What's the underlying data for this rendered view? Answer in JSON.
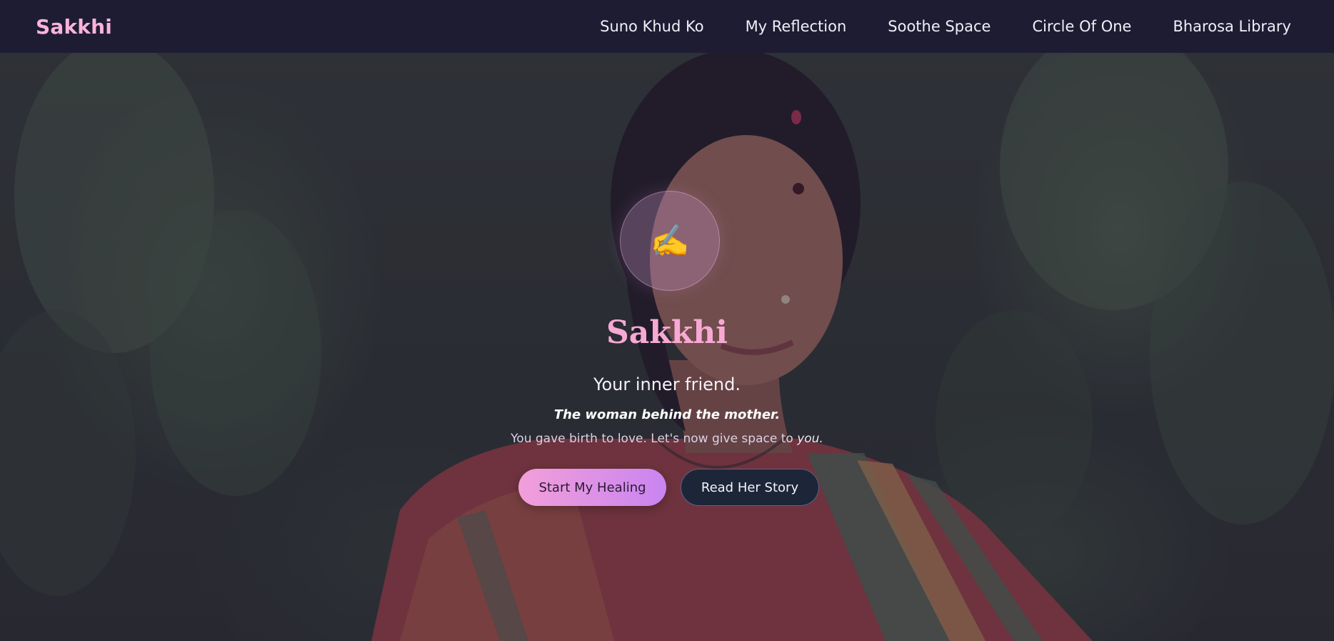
{
  "header": {
    "brand": "Sakkhi",
    "nav": [
      {
        "label": "Suno Khud Ko"
      },
      {
        "label": "My Reflection"
      },
      {
        "label": "Soothe Space"
      },
      {
        "label": "Circle Of One"
      },
      {
        "label": "Bharosa Library"
      }
    ]
  },
  "hero": {
    "icon": "writing-hand-icon",
    "icon_glyph": "✍️",
    "title": "Sakkhi",
    "subtitle": "Your inner friend.",
    "tagline": "The woman behind the mother.",
    "body_prefix": "You gave birth to love. Let's now give space to ",
    "body_emphasis": "you.",
    "primary_button": "Start My Healing",
    "secondary_button": "Read Her Story"
  },
  "colors": {
    "navbar_bg": "#1e1c33",
    "brand": "#f9b3db",
    "title": "#f7a9d3",
    "primary_gradient_start": "#f29fd9",
    "primary_gradient_end": "#c984f1",
    "secondary_bg": "#1d2539"
  }
}
